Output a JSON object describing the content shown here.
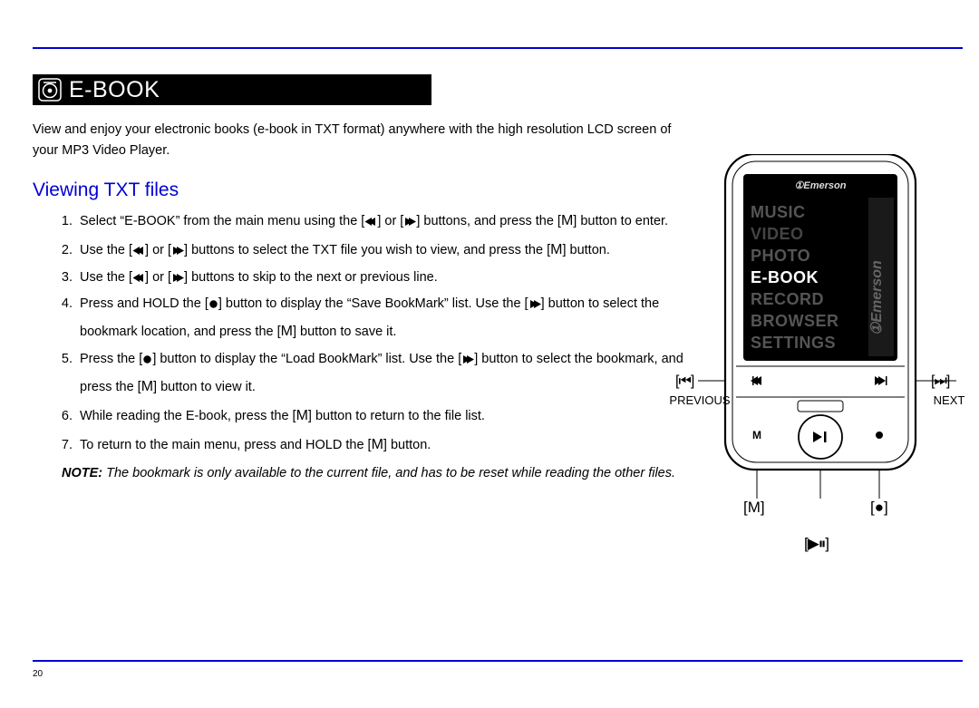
{
  "page_number": "20",
  "banner": {
    "title": "E-BOOK"
  },
  "intro": "View and enjoy your electronic books (e-book in TXT format) anywhere with the high resolution LCD screen of your MP3 Video Player.",
  "section_title": "Viewing TXT files",
  "steps": {
    "s1a": "Select “",
    "s1b": "E-BOOK",
    "s1c": "” from the main menu using the [",
    "s1d": "] or [",
    "s1e": "] buttons, and press the [",
    "s1f": "M",
    "s1g": "] button to enter.",
    "s2a": "Use the [",
    "s2b": "] or [",
    "s2c": "] buttons to select the TXT file you wish to view, and press the [",
    "s2d": "M",
    "s2e": "] button.",
    "s3a": "Use the [",
    "s3b": "] or [",
    "s3c": "] buttons to skip to the next or previous line.",
    "s4a": "Press and HOLD the [",
    "s4b": "] button to display the “",
    "s4c": "Save BookMark",
    "s4d": "” list.  Use the [",
    "s4e": "] button to select the bookmark location, and press the [",
    "s4f": "M",
    "s4g": "] button to save it.",
    "s5a": "Press the [",
    "s5b": "] button to display the “",
    "s5c": "Load BookMark",
    "s5d": "” list.  Use the [",
    "s5e": "] button to select the bookmark, and press the [",
    "s5f": "M",
    "s5g": "] button to view it.",
    "s6a": "While reading the E-book, press the [",
    "s6b": "M",
    "s6c": "] button to return to the file list.",
    "s7a": "To return to the main menu, press and HOLD the [",
    "s7b": "M",
    "s7c": "] button."
  },
  "note": {
    "lead": "NOTE:",
    "rest": " The bookmark is only available to the current file, and has to be reset while reading the other files."
  },
  "device": {
    "brand": "Emerson",
    "menu": [
      "MUSIC",
      "VIDEO",
      "PHOTO",
      "E-BOOK",
      "RECORD",
      "BROWSER",
      "SETTINGS"
    ],
    "selected": "E-BOOK",
    "prev_label": "PREVIOUS",
    "next_label": "NEXT",
    "prev_symbol": "[⏮]",
    "next_symbol": "[⏭]",
    "m_symbol": "[M]",
    "dot_symbol": "[●]",
    "playpause_symbol": "[▶⏸]"
  }
}
